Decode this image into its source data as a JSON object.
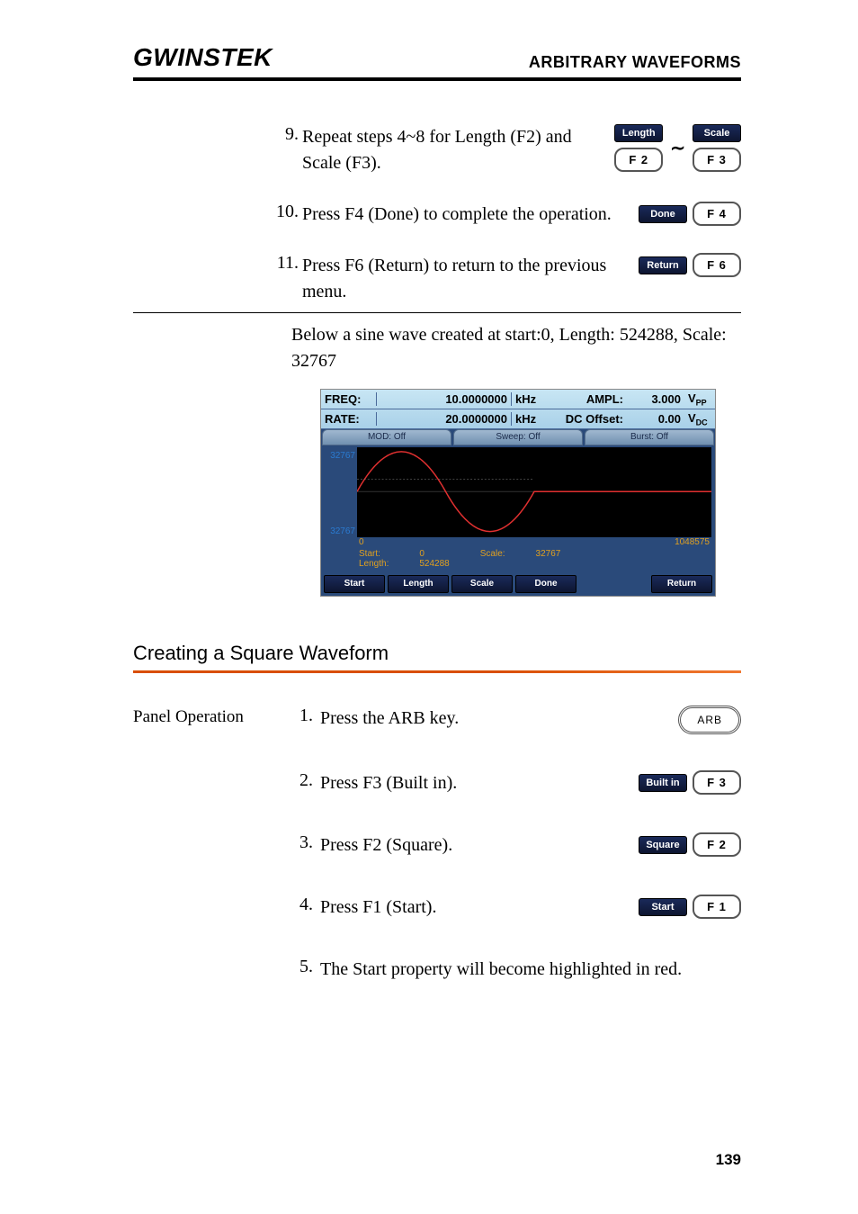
{
  "header": {
    "logo": "GWINSTEK",
    "section": "ARBITRARY WAVEFORMS"
  },
  "steps_top": {
    "s9": {
      "num": "9.",
      "text": "Repeat steps 4~8 for Length (F2) and Scale (F3).",
      "btn1": "Length",
      "f1": "F 2",
      "btn2": "Scale",
      "f2": "F 3"
    },
    "s10": {
      "num": "10.",
      "text": "Press F4 (Done) to complete the operation.",
      "btn": "Done",
      "f": "F 4"
    },
    "s11": {
      "num": "11.",
      "text": "Press F6 (Return) to return to the previous menu.",
      "btn": "Return",
      "f": "F 6"
    }
  },
  "caption": "Below a sine wave created at start:0, Length: 524288, Scale: 32767",
  "device": {
    "row1": {
      "label": "FREQ:",
      "val": "10.0000000",
      "unit": "kHz",
      "r_label": "AMPL:",
      "r_val": "3.000",
      "r_unit": "VPP"
    },
    "row2": {
      "label": "RATE:",
      "val": "20.0000000",
      "unit": "kHz",
      "r_label": "DC Offset:",
      "r_val": "0.00",
      "r_unit": "VDC"
    },
    "tabs": {
      "t1": "MOD: Off",
      "t2": "Sweep: Off",
      "t3": "Burst: Off"
    },
    "yhigh": "32767",
    "ylow": "32767",
    "xmin": "0",
    "xmax": "1048575",
    "info": {
      "start_l": "Start:",
      "start_v": "0",
      "len_l": "Length:",
      "len_v": "524288",
      "scale_l": "Scale:",
      "scale_v": "32767"
    },
    "soft": {
      "b1": "Start",
      "b2": "Length",
      "b3": "Scale",
      "b4": "Done",
      "b6": "Return"
    }
  },
  "h2": "Creating a Square Waveform",
  "panel_op": "Panel Operation",
  "steps_bot": {
    "s1": {
      "num": "1.",
      "text": "Press the ARB key.",
      "key": "ARB"
    },
    "s2": {
      "num": "2.",
      "text": "Press F3 (Built in).",
      "btn": "Built in",
      "f": "F 3"
    },
    "s3": {
      "num": "3.",
      "text": "Press F2 (Square).",
      "btn": "Square",
      "f": "F 2"
    },
    "s4": {
      "num": "4.",
      "text": "Press F1 (Start).",
      "btn": "Start",
      "f": "F 1"
    },
    "s5": {
      "num": "5.",
      "text": "The Start property will become highlighted in red."
    }
  },
  "page": "139"
}
